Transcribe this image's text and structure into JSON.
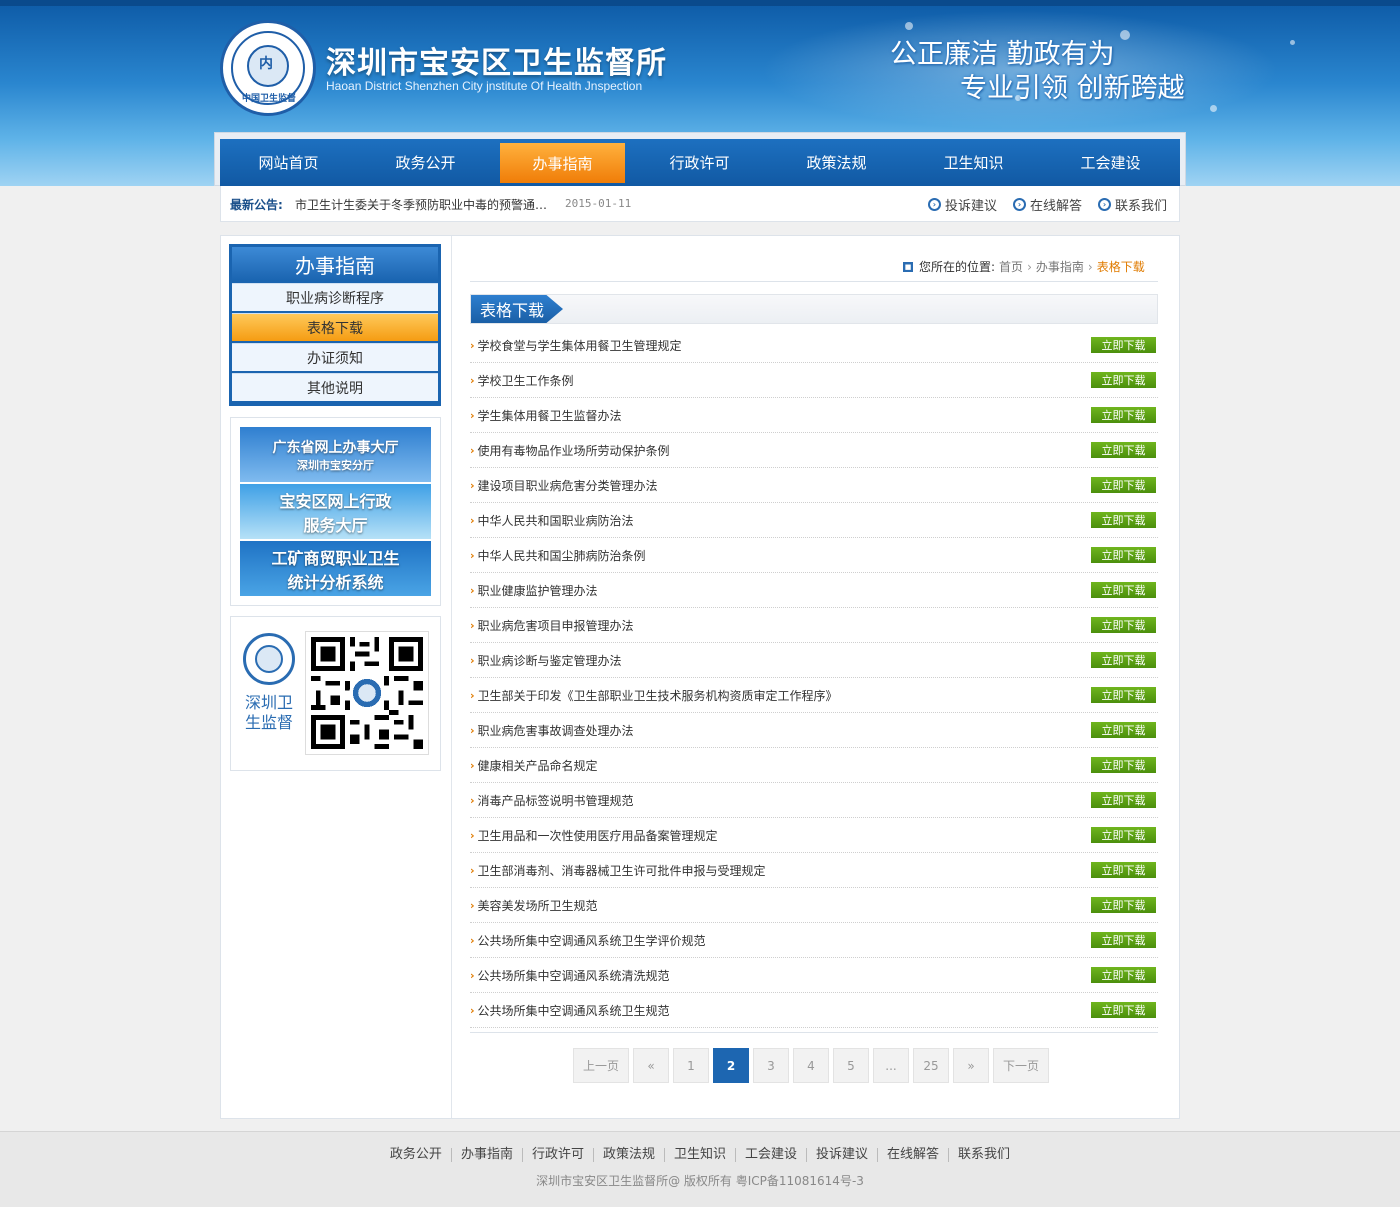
{
  "header": {
    "title": "深圳市宝安区卫生监督所",
    "subtitle": "Haoan District Shenzhen City jnstitute Of Health Jnspection",
    "logo_core": "内",
    "logo_bottom": "中国卫生监督",
    "slogan_1": "公正廉洁 勤政有为",
    "slogan_2": "专业引领 创新跨越",
    "colors": {
      "primary": "#1159a3",
      "accent": "#f07d08",
      "download": "#5aa114"
    }
  },
  "nav": {
    "items": [
      {
        "label": "网站首页"
      },
      {
        "label": "政务公开"
      },
      {
        "label": "办事指南"
      },
      {
        "label": "行政许可"
      },
      {
        "label": "政策法规"
      },
      {
        "label": "卫生知识"
      },
      {
        "label": "工会建设"
      }
    ],
    "active": "办事指南"
  },
  "notice": {
    "label": "最新公告:",
    "text": "市卫生计生委关于冬季预防职业中毒的预警通…",
    "date": "2015-01-11"
  },
  "quick_links": [
    {
      "label": "投诉建议",
      "icon": "arrow-circle-icon"
    },
    {
      "label": "在线解答",
      "icon": "arrow-circle-icon"
    },
    {
      "label": "联系我们",
      "icon": "arrow-circle-icon"
    }
  ],
  "sidebar": {
    "title": "办事指南",
    "items": [
      {
        "label": "职业病诊断程序"
      },
      {
        "label": "表格下载"
      },
      {
        "label": "办证须知"
      },
      {
        "label": "其他说明"
      }
    ],
    "active": "表格下载",
    "banners": [
      {
        "line1": "广东省网上办事大厅",
        "line2": "深圳市宝安分厅"
      },
      {
        "line1": "宝安区网上行政",
        "line2": "服务大厅"
      },
      {
        "line1": "工矿商贸职业卫生",
        "line2": "统计分析系统"
      }
    ],
    "qr_name": "深圳卫生监督"
  },
  "breadcrumb": {
    "prefix": "您所在的位置:",
    "home": "首页",
    "parent": "办事指南",
    "current": "表格下载"
  },
  "section": {
    "title": "表格下载"
  },
  "files": {
    "button_label": "立即下载",
    "items": [
      "学校食堂与学生集体用餐卫生管理规定",
      "学校卫生工作条例",
      "学生集体用餐卫生监督办法",
      "使用有毒物品作业场所劳动保护条例",
      "建设项目职业病危害分类管理办法",
      "中华人民共和国职业病防治法",
      "中华人民共和国尘肺病防治条例",
      "职业健康监护管理办法",
      "职业病危害项目申报管理办法",
      "职业病诊断与鉴定管理办法",
      "卫生部关于印发《卫生部职业卫生技术服务机构资质审定工作程序》",
      "职业病危害事故调查处理办法",
      "健康相关产品命名规定",
      "消毒产品标签说明书管理规范",
      "卫生用品和一次性使用医疗用品备案管理规定",
      "卫生部消毒剂、消毒器械卫生许可批件申报与受理规定",
      "美容美发场所卫生规范",
      "公共场所集中空调通风系统卫生学评价规范",
      "公共场所集中空调通风系统清洗规范",
      "公共场所集中空调通风系统卫生规范"
    ]
  },
  "pager": {
    "prev": "上一页",
    "first": "«",
    "pages": [
      "1",
      "2",
      "3",
      "4",
      "5"
    ],
    "current": "2",
    "ellipsis": "...",
    "last_page": "25",
    "last": "»",
    "next": "下一页"
  },
  "footer": {
    "links": [
      "政务公开",
      "办事指南",
      "行政许可",
      "政策法规",
      "卫生知识",
      "工会建设",
      "投诉建议",
      "在线解答",
      "联系我们"
    ],
    "copyright": "深圳市宝安区卫生监督所@ 版权所有   粤ICP备11081614号-3"
  }
}
